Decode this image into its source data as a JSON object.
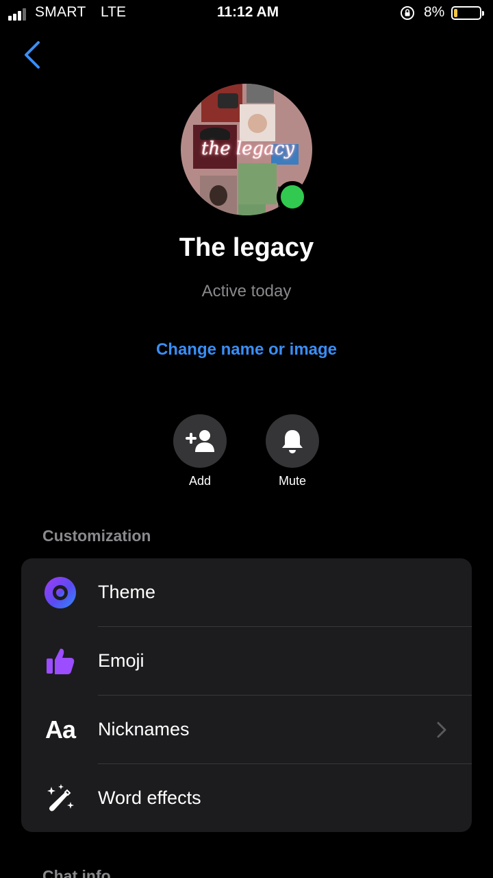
{
  "status_bar": {
    "carrier": "SMART",
    "network": "LTE",
    "time": "11:12 AM",
    "battery_percent": "8%",
    "battery_level": 0.08,
    "signal_bars": 3,
    "signal_bars_total": 4,
    "icons": [
      "signal-icon",
      "orientation-lock-icon",
      "battery-icon"
    ]
  },
  "nav": {
    "back_icon": "chevron-left-icon"
  },
  "profile": {
    "name": "The legacy",
    "status": "Active today",
    "avatar_caption": "the legacy",
    "online": true,
    "change_link": "Change name or image"
  },
  "actions": [
    {
      "label": "Add",
      "icon": "add-person-icon"
    },
    {
      "label": "Mute",
      "icon": "bell-icon"
    }
  ],
  "customization": {
    "header": "Customization",
    "items": [
      {
        "label": "Theme",
        "icon": "theme-circle-icon",
        "has_chevron": false
      },
      {
        "label": "Emoji",
        "icon": "thumbs-up-icon",
        "has_chevron": false
      },
      {
        "label": "Nicknames",
        "icon": "aa-text-icon",
        "icon_text": "Aa",
        "has_chevron": true
      },
      {
        "label": "Word effects",
        "icon": "magic-wand-icon",
        "has_chevron": false
      }
    ]
  },
  "next_section_header": "Chat info",
  "colors": {
    "background": "#000000",
    "accent_blue": "#3a8ef6",
    "card": "#1c1c1e",
    "secondary_text": "#8a8a8e",
    "online_green": "#31c94f",
    "emoji_purple": "#9b4dff",
    "battery_yellow": "#f6c543"
  }
}
